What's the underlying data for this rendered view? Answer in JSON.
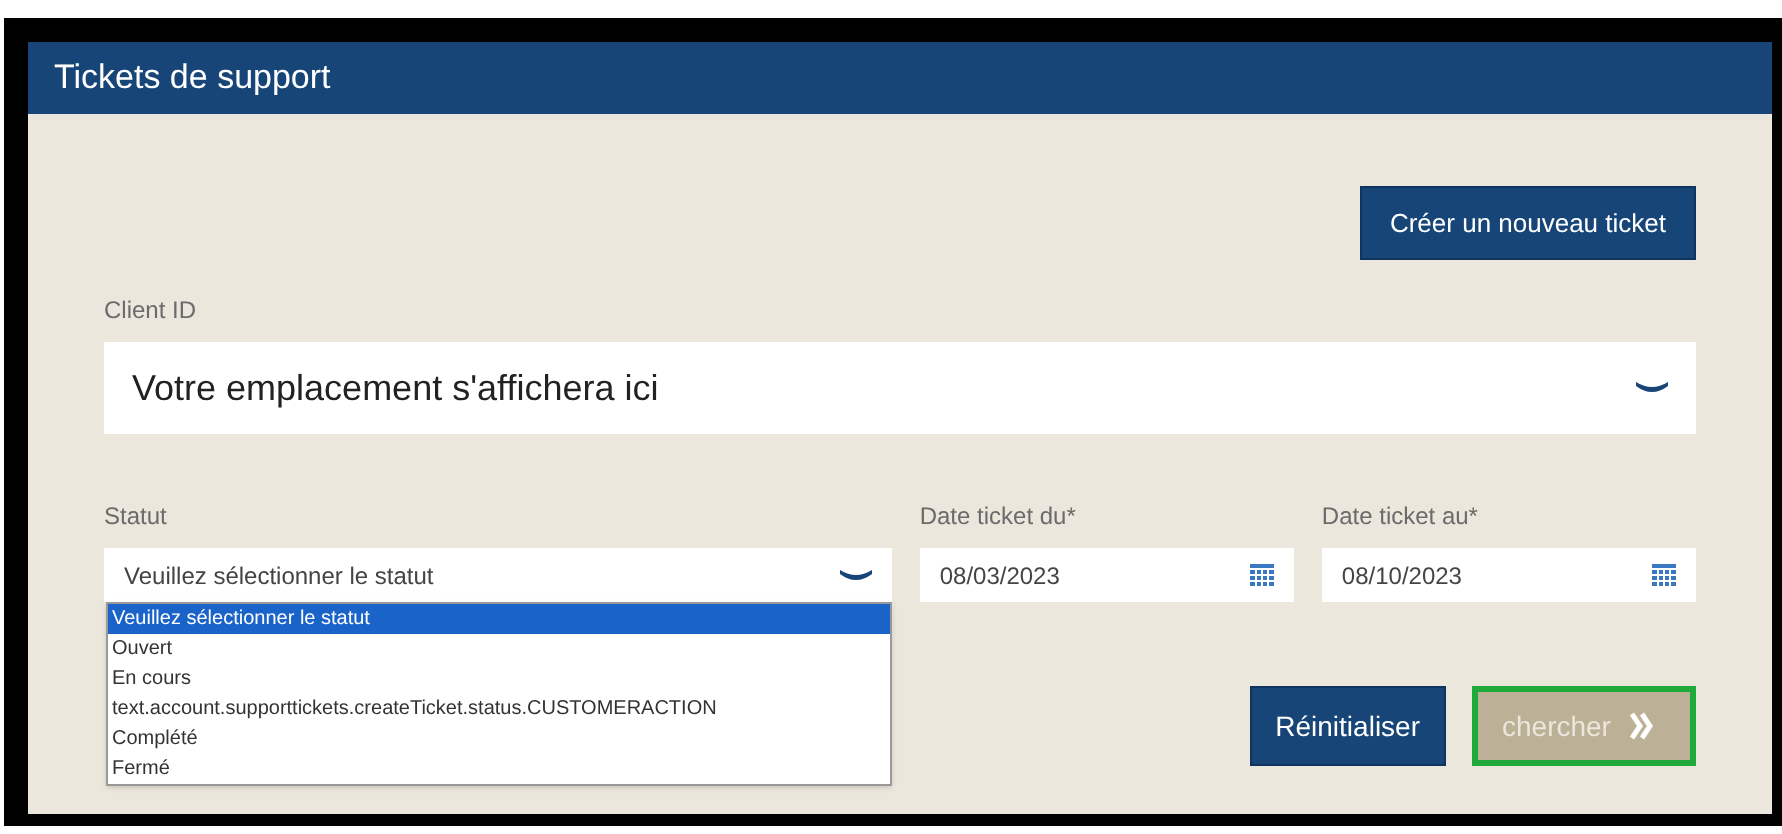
{
  "header": {
    "title": "Tickets de support"
  },
  "create_button": "Créer un nouveau ticket",
  "client_id": {
    "label": "Client ID",
    "value": "Votre emplacement s'affichera ici"
  },
  "status": {
    "label": "Statut",
    "value": "Veuillez sélectionner le statut",
    "expanded": true,
    "options": [
      {
        "label": "Veuillez sélectionner le statut",
        "selected": true
      },
      {
        "label": "Ouvert",
        "selected": false
      },
      {
        "label": "En cours",
        "selected": false
      },
      {
        "label": "text.account.supporttickets.createTicket.status.CUSTOMERACTION",
        "selected": false
      },
      {
        "label": "Complété",
        "selected": false
      },
      {
        "label": "Fermé",
        "selected": false
      }
    ]
  },
  "date_from": {
    "label": "Date ticket du*",
    "value": "08/03/2023"
  },
  "date_to": {
    "label": "Date ticket au*",
    "value": "08/10/2023"
  },
  "buttons": [
    {
      "label": "Réinitialiser",
      "disabled": false,
      "highlighted": false
    },
    {
      "label": "chercher",
      "disabled": true,
      "highlighted": true
    }
  ]
}
